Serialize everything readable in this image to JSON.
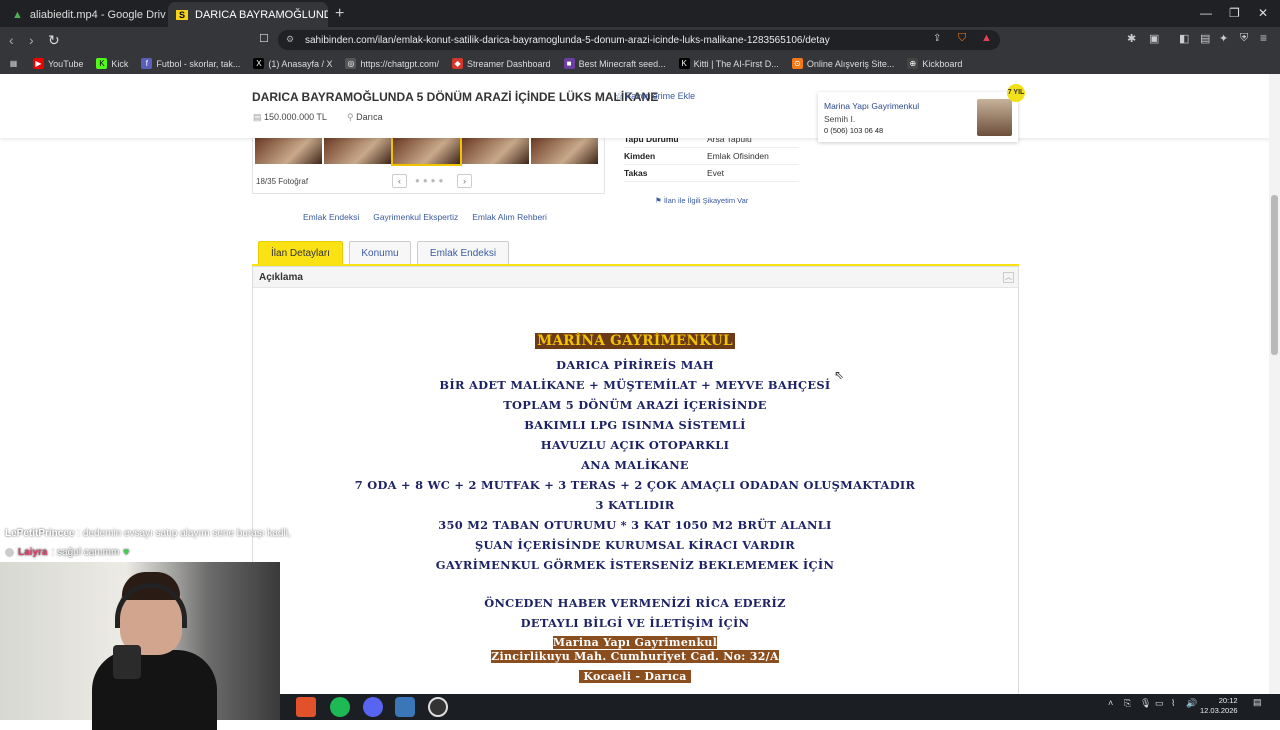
{
  "browser": {
    "tabs": [
      {
        "title": "aliabiedit.mp4 - Google Drive",
        "active": false
      },
      {
        "title": "DARICA BAYRAMOĞLUNDA 5 DÖ",
        "active": true
      }
    ],
    "url": "sahibinden.com/ilan/emlak-konut-satilik-darica-bayramoglunda-5-donum-arazi-icinde-luks-malikane-1283565106/detay",
    "bookmarks": [
      "YouTube",
      "Kick",
      "Futbol - skorlar, tak...",
      "(1) Anasayfa / X",
      "https://chatgpt.com/",
      "Streamer Dashboard",
      "Best Minecraft seed...",
      "Kitti | The AI-First D...",
      "Online Alışveriş Site...",
      "Kickboard"
    ]
  },
  "listing": {
    "title": "DARICA BAYRAMOĞLUNDA 5 DÖNÜM ARAZİ İÇİNDE LÜKS MALİKANE",
    "favorite": "Favorilerime Ekle",
    "price": "150.000.000 TL",
    "location": "Darıca",
    "photo_count": "18/35 Fotoğraf",
    "info": [
      {
        "key": "Tapu Durumu",
        "value": "Arsa Tapulu"
      },
      {
        "key": "Kimden",
        "value": "Emlak Ofisinden"
      },
      {
        "key": "Takas",
        "value": "Evet"
      }
    ],
    "complaint": "İlan ile İlgili Şikayetim Var",
    "links": [
      "Emlak Endeksi",
      "Gayrimenkul Ekspertiz",
      "Emlak Alım Rehberi"
    ],
    "tabs": [
      "İlan Detayları",
      "Konumu",
      "Emlak Endeksi"
    ],
    "section_title": "Açıklama"
  },
  "agent": {
    "company": "Marina Yapı Gayrimenkul",
    "person": "Semih I.",
    "phone": "0 (506) 103 06 48",
    "badge": "7 YIL"
  },
  "description": {
    "brand": "MARİNA GAYRİMENKUL",
    "lines": [
      "DARICA PİRİREİS MAH",
      "BİR ADET MALİKANE + MÜŞTEMİLAT + MEYVE BAHÇESİ",
      "TOPLAM 5 DÖNÜM ARAZİ İÇERİSİNDE",
      "BAKIMLI LPG ISINMA SİSTEMLİ",
      "HAVUZLU AÇIK OTOPARKLI",
      "ANA MALİKANE",
      "7 ODA + 8 WC + 2 MUTFAK + 3 TERAS + 2 ÇOK AMAÇLI ODADAN OLUŞMAKTADIR",
      "3 KATLIDIR",
      "350 M2 TABAN OTURUMU * 3 KAT 1050 M2 BRÜT ALANLI",
      "ŞUAN İÇERİSİNDE KURUMSAL KİRACI VARDIR",
      "GAYRİMENKUL GÖRMEK İSTERSENİZ BEKLEMEMEK İÇİN",
      "ÖNCEDEN HABER VERMENİZİ RİCA EDERİZ",
      "DETAYLI BİLGİ VE İLETİŞİM İÇİN"
    ],
    "footer": [
      "Marina Yapı Gayrimenkul",
      "Zincirlikuyu Mah. Cumhuriyet Cad. No: 32/A",
      "Kocaeli - Darıca"
    ]
  },
  "chat": [
    {
      "user": "LePetitPrincee",
      "message": ": dedemin evsayı satıp alayım sene buraşı kadli,"
    },
    {
      "user": "Laiyra",
      "message": ": sağol canımm"
    }
  ],
  "system": {
    "time": "20:12",
    "date": "12.03.2026"
  }
}
